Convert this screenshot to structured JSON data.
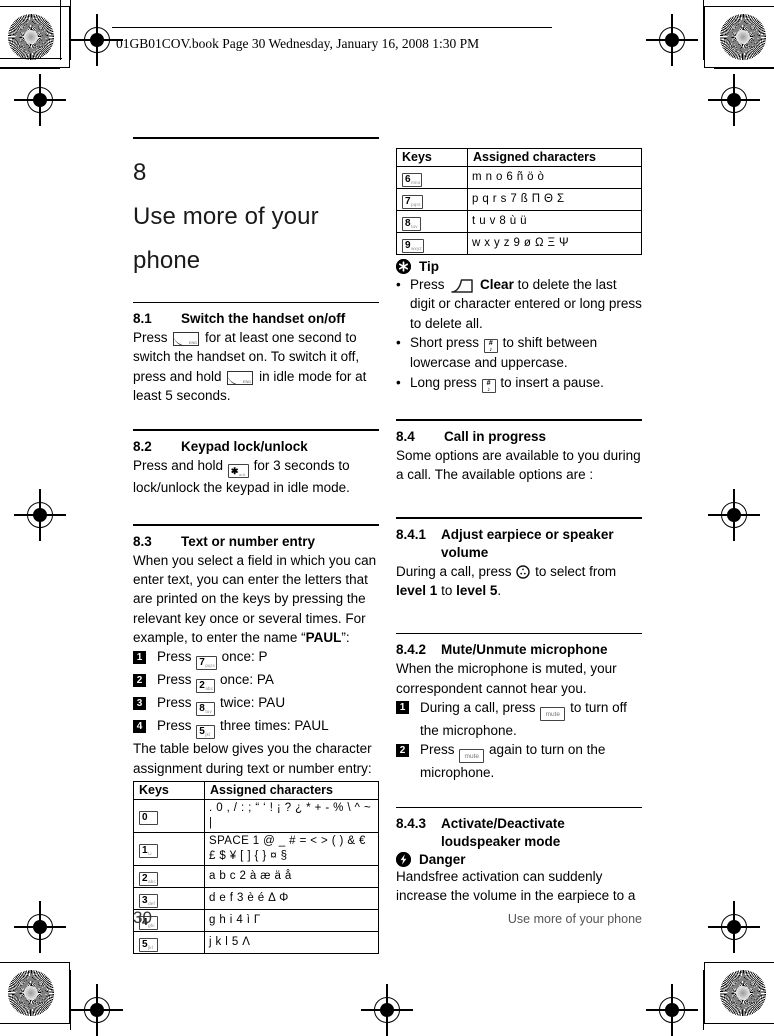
{
  "header": {
    "file_line": "01GB01COV.book  Page 30  Wednesday, January 16, 2008  1:30 PM"
  },
  "chapter": {
    "number": "8",
    "title": "Use more of your phone"
  },
  "sections": {
    "s81": {
      "number": "8.1",
      "title": "Switch the handset on/off",
      "p1a": "Press",
      "p1b": "for at least one second to switch the handset on. To switch it off, press and hold",
      "p1c": "in idle mode for at least 5 seconds."
    },
    "s82": {
      "number": "8.2",
      "title": "Keypad lock/unlock",
      "p1a": "Press and hold",
      "p1b": "for 3 seconds to lock/unlock the keypad in idle mode."
    },
    "s83": {
      "number": "8.3",
      "title": "Text or number entry",
      "p1": "When you select a field in which you can enter text, you can enter the letters that are printed on the keys by pressing the relevant key once or several times. For example, to enter the name “",
      "p1_bold": "PAUL",
      "p1_end": "”:",
      "steps": [
        {
          "n": "1",
          "pre": "Press",
          "key": "7",
          "keysub": "pqrs",
          "post": "once: P"
        },
        {
          "n": "2",
          "pre": "Press",
          "key": "2",
          "keysub": "abc",
          "post": "once: PA"
        },
        {
          "n": "3",
          "pre": "Press",
          "key": "8",
          "keysub": "tuv",
          "post": "twice: PAU"
        },
        {
          "n": "4",
          "pre": "Press",
          "key": "5",
          "keysub": "jkl",
          "post": "three times: PAUL"
        }
      ],
      "p2": "The table below gives you the character assignment during text or number entry:"
    },
    "s84": {
      "number": "8.4",
      "title": "Call in progress",
      "p1": "Some options are available to you during a call. The available options are :"
    },
    "s841": {
      "number": "8.4.1",
      "title_l1": "Adjust earpiece or speaker",
      "title_l2": "volume",
      "p1a": "During a call, press",
      "p1b": "to select from",
      "p1_b1": "level 1",
      "p1_mid": "to",
      "p1_b2": "level 5",
      "p1_end": "."
    },
    "s842": {
      "number": "8.4.2",
      "title": "Mute/Unmute microphone",
      "p1": "When the microphone is muted, your correspondent cannot hear you.",
      "steps": [
        {
          "n": "1",
          "pre": "During a call, press",
          "key": "mute",
          "post": "to turn off the microphone."
        },
        {
          "n": "2",
          "pre": "Press",
          "key": "mute",
          "post": "again to turn on the microphone."
        }
      ]
    },
    "s843": {
      "number": "8.4.3",
      "title_l1": "Activate/Deactivate",
      "title_l2": "loudspeaker mode",
      "danger_label": "Danger",
      "p1": "Handsfree activation can suddenly increase the volume in the earpiece to a"
    }
  },
  "tip": {
    "label": "Tip",
    "items": [
      {
        "pre": "Press",
        "key": "clear",
        "bold": "Clear",
        "post": "to delete the last digit or character entered or long press to delete all."
      },
      {
        "pre": "Short press",
        "key": "hash",
        "post": "to shift between lowercase and uppercase."
      },
      {
        "pre": "Long press",
        "key": "hash",
        "post": "to insert a pause."
      }
    ]
  },
  "table_right": {
    "headers": [
      "Keys",
      "Assigned characters"
    ],
    "rows": [
      {
        "key": "6",
        "keysub": "mno",
        "chars": "m n o 6 ñ ö ò"
      },
      {
        "key": "7",
        "keysub": "pqrs",
        "chars": "p q r s 7 ß Π Θ Σ"
      },
      {
        "key": "8",
        "keysub": "tuv",
        "chars": "t u v 8 ù ü"
      },
      {
        "key": "9",
        "keysub": "wxyz",
        "chars": "w x y z 9 ø Ω Ξ Ψ"
      }
    ]
  },
  "table_left": {
    "headers": [
      "Keys",
      "Assigned characters"
    ],
    "rows": [
      {
        "key": "0",
        "keysub": "",
        "chars": ". 0 , / : ;   “ ‘ ! ¡ ? ¿ * + - % \\ ^ ~ |"
      },
      {
        "key": "1",
        "keysub": "⊔",
        "chars": "SPACE 1 @ _ # = < > ( ) & € £ $ ¥ [ ] { } ¤ §"
      },
      {
        "key": "2",
        "keysub": "abc",
        "chars": "a b c 2 à æ ä å"
      },
      {
        "key": "3",
        "keysub": "def",
        "chars": "d e f 3 è é Δ Φ"
      },
      {
        "key": "4",
        "keysub": "ghi",
        "chars": "g h i 4 ì Γ"
      },
      {
        "key": "5",
        "keysub": "jkl",
        "chars": "j k l 5 Λ"
      }
    ]
  },
  "footer": {
    "page_number": "30",
    "running_title": "Use more of your phone"
  },
  "colors": {
    "ink": "#000000",
    "muted": "#555555",
    "page_bg": "#ffffff"
  }
}
